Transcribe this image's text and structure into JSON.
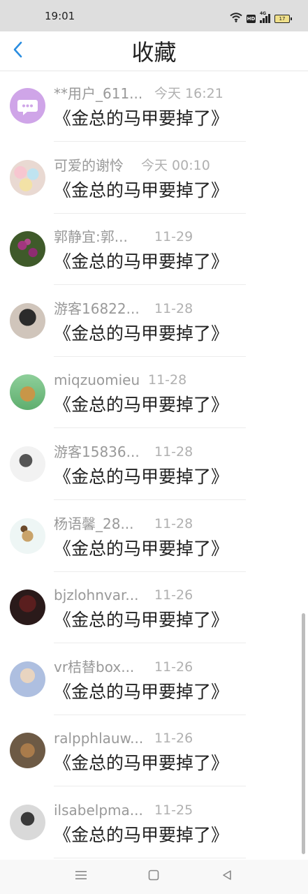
{
  "status_bar": {
    "time": "19:01",
    "hd_label": "HD",
    "network_label": "4G",
    "battery_label": "17",
    "icons": [
      "wifi-icon",
      "hd-icon",
      "signal-icon",
      "battery-icon"
    ]
  },
  "header": {
    "title": "收藏",
    "back_icon": "chevron-left-icon",
    "accent_color": "#2a8de0"
  },
  "favorites": [
    {
      "user": "**用户_611...",
      "time": "今天 16:21",
      "title": "《金总的马甲要掉了》",
      "avatar": "chat-bubble-avatar"
    },
    {
      "user": "可爱的谢怜",
      "time": "今天 00:10",
      "title": "《金总的马甲要掉了》",
      "avatar": "macaron-avatar"
    },
    {
      "user": "郭静宜:郭...",
      "time": "11-29",
      "title": "《金总的马甲要掉了》",
      "avatar": "flowers-avatar"
    },
    {
      "user": "游客16822...",
      "time": "11-28",
      "title": "《金总的马甲要掉了》",
      "avatar": "person-avatar"
    },
    {
      "user": "miqzuomieu",
      "time": "11-28",
      "title": "《金总的马甲要掉了》",
      "avatar": "cartoon-avatar"
    },
    {
      "user": "游客15836...",
      "time": "11-28",
      "title": "《金总的马甲要掉了》",
      "avatar": "sketch-avatar"
    },
    {
      "user": "杨语馨_28...",
      "time": "11-28",
      "title": "《金总的马甲要掉了》",
      "avatar": "cute-animal-avatar"
    },
    {
      "user": "bjzlohnvar...",
      "time": "11-26",
      "title": "《金总的马甲要掉了》",
      "avatar": "dark-photo-avatar"
    },
    {
      "user": "vr桔替box...",
      "time": "11-26",
      "title": "《金总的马甲要掉了》",
      "avatar": "girl-photo-avatar"
    },
    {
      "user": "ralpphlauw...",
      "time": "11-26",
      "title": "《金总的马甲要掉了》",
      "avatar": "pet-photo-avatar"
    },
    {
      "user": "ilsabelpma...",
      "time": "11-25",
      "title": "《金总的马甲要掉了》",
      "avatar": "portrait-avatar"
    }
  ],
  "bottom_nav": {
    "items": [
      "menu-icon",
      "home-icon",
      "back-triangle-icon"
    ]
  }
}
